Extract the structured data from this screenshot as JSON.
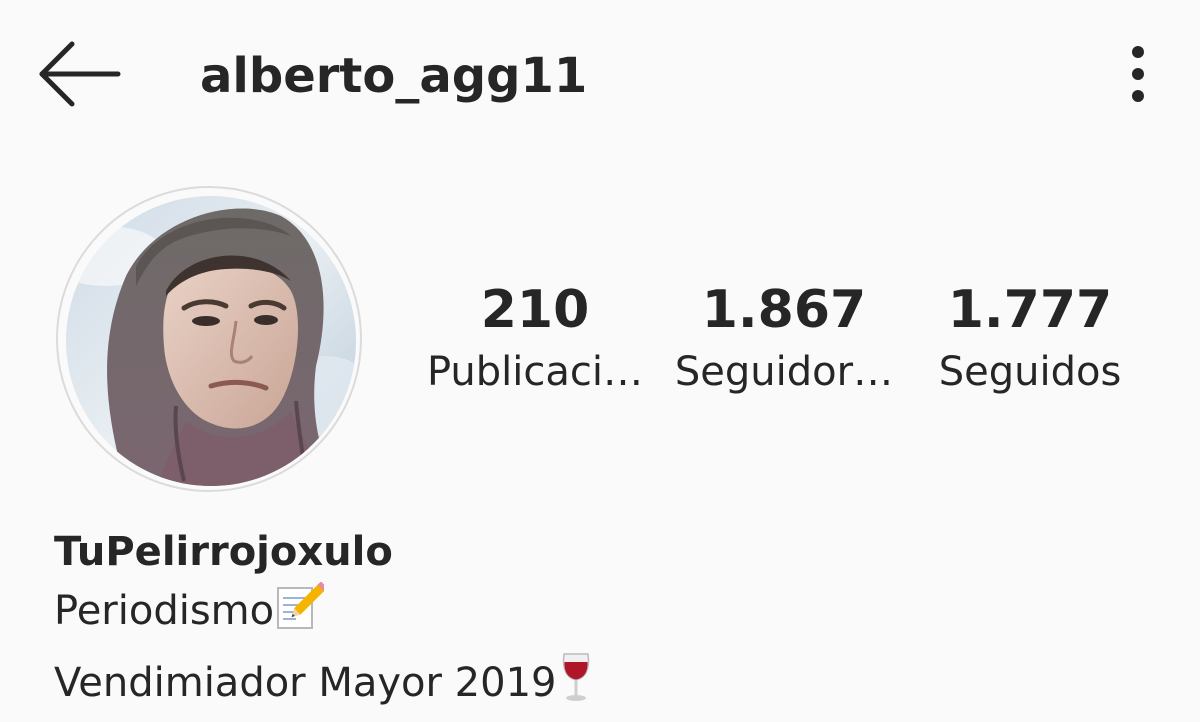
{
  "header": {
    "username": "alberto_agg11",
    "back_icon": "arrow-left-icon",
    "menu_icon": "more-vertical-icon"
  },
  "profile": {
    "avatar_icon": "profile-photo"
  },
  "stats": {
    "posts_count": "210",
    "posts_label": "Publicaci…",
    "followers_count": "1.867",
    "followers_label": "Seguidor…",
    "following_count": "1.777",
    "following_label": "Seguidos"
  },
  "bio": {
    "display_name": "TuPelirrojoxulo",
    "line1": "Periodismo",
    "line1_emoji": "memo-icon",
    "line2": "Vendimiador Mayor 2019",
    "line2_emoji": "wine-glass-icon"
  },
  "colors": {
    "background": "#fafafa",
    "text": "#262626",
    "avatar_border": "#dbdbdb"
  }
}
